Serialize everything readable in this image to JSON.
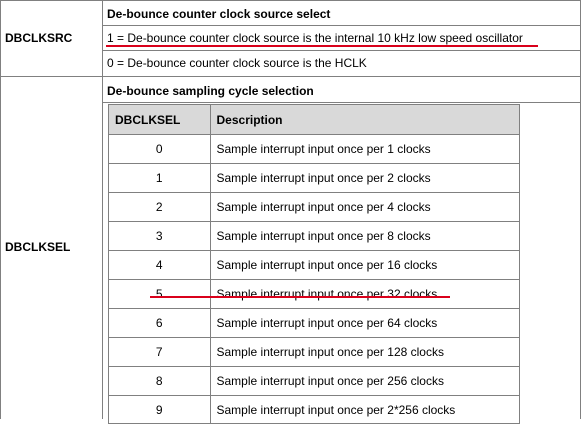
{
  "dbclksrc": {
    "label": "DBCLKSRC",
    "heading": "De-bounce counter clock source select",
    "option_1": "1 = De-bounce counter clock source is the internal 10 kHz low speed oscillator",
    "option_0": "0 = De-bounce counter clock source is the HCLK"
  },
  "dbclksel": {
    "label": "DBCLKSEL",
    "heading": "De-bounce sampling cycle selection",
    "table": {
      "col_value": "DBCLKSEL",
      "col_desc": "Description",
      "rows": [
        {
          "value": "0",
          "desc": "Sample interrupt input once per 1 clocks"
        },
        {
          "value": "1",
          "desc": "Sample interrupt input once per 2 clocks"
        },
        {
          "value": "2",
          "desc": "Sample interrupt input once per 4 clocks"
        },
        {
          "value": "3",
          "desc": "Sample interrupt input once per 8 clocks"
        },
        {
          "value": "4",
          "desc": "Sample interrupt input once per 16 clocks"
        },
        {
          "value": "5",
          "desc": "Sample interrupt input once per 32 clocks"
        },
        {
          "value": "6",
          "desc": "Sample interrupt input once per 64 clocks"
        },
        {
          "value": "7",
          "desc": "Sample interrupt input once per 128 clocks"
        },
        {
          "value": "8",
          "desc": "Sample interrupt input once per 256 clocks"
        },
        {
          "value": "9",
          "desc": "Sample interrupt input once per 2*256 clocks"
        }
      ]
    }
  },
  "colors": {
    "border": "#808080",
    "header_fill": "#d9d9d9",
    "highlight_underline": "#d9001b"
  }
}
